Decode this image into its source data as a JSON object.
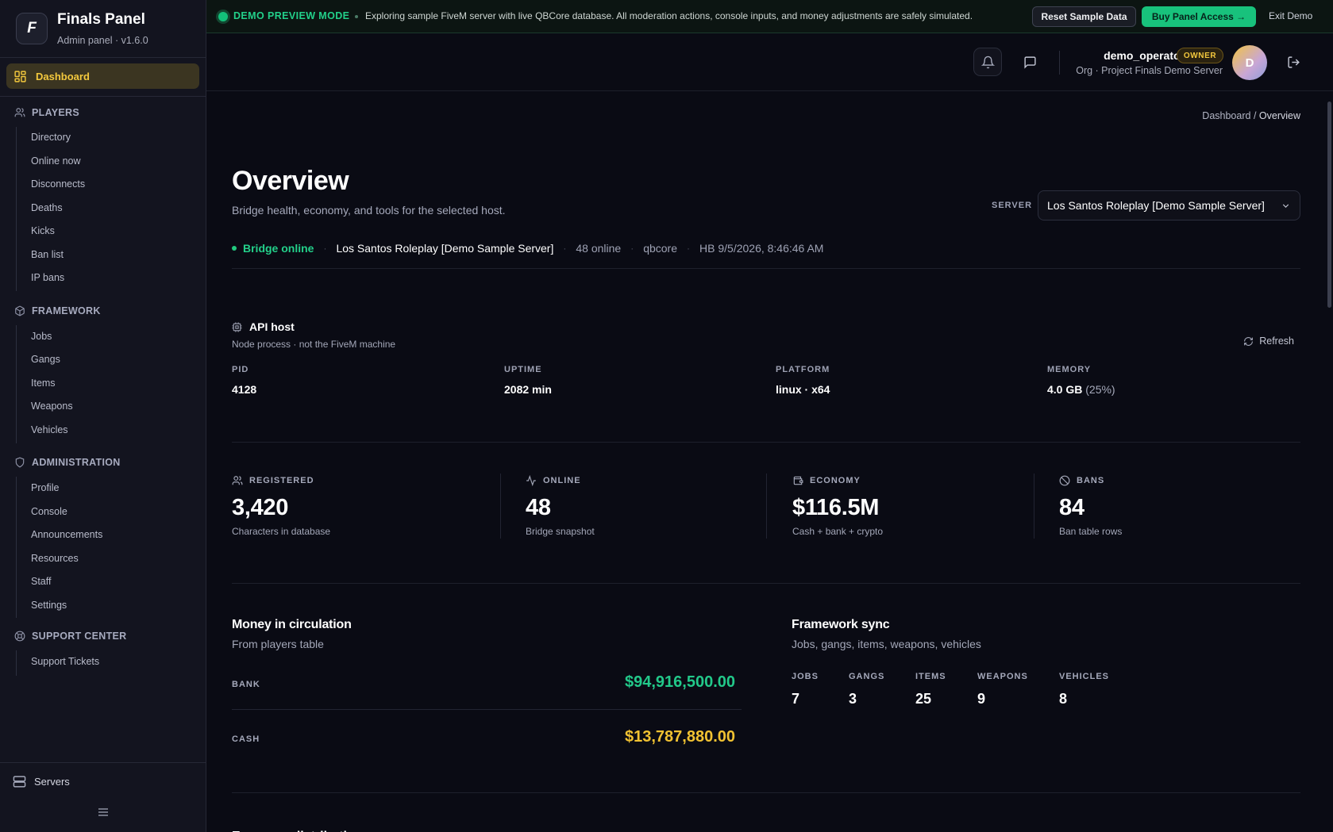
{
  "brand": {
    "logo_letter": "F",
    "title": "Finals Panel",
    "subtitle": "Admin panel · v1.6.0"
  },
  "sidebar": {
    "dashboard": "Dashboard",
    "sections": [
      {
        "title": "PLAYERS",
        "items": [
          "Directory",
          "Online now",
          "Disconnects",
          "Deaths",
          "Kicks",
          "Ban list",
          "IP bans"
        ]
      },
      {
        "title": "FRAMEWORK",
        "items": [
          "Jobs",
          "Gangs",
          "Items",
          "Weapons",
          "Vehicles"
        ]
      },
      {
        "title": "ADMINISTRATION",
        "items": [
          "Profile",
          "Console",
          "Announcements",
          "Resources",
          "Staff",
          "Settings"
        ]
      },
      {
        "title": "SUPPORT CENTER",
        "items": [
          "Support Tickets"
        ]
      }
    ],
    "servers": "Servers"
  },
  "banner": {
    "mode": "DEMO PREVIEW MODE",
    "text": "Exploring sample FiveM server with live QBCore database. All moderation actions, console inputs, and money adjustments are safely simulated.",
    "reset": "Reset Sample Data",
    "buy": "Buy Panel Access →",
    "exit": "Exit Demo"
  },
  "header": {
    "user": "demo_operator",
    "role": "OWNER",
    "org": "Org · Project Finals Demo Server",
    "avatar_letter": "D"
  },
  "breadcrumb": {
    "root": "Dashboard",
    "sep": "/",
    "current": "Overview"
  },
  "page": {
    "title": "Overview",
    "subtitle": "Bridge health, economy, and tools for the selected host.",
    "server_label": "SERVER",
    "server_selected": "Los Santos Roleplay [Demo Sample Server]"
  },
  "status": {
    "bridge": "Bridge online",
    "server": "Los Santos Roleplay [Demo Sample Server]",
    "online": "48 online",
    "framework": "qbcore",
    "heartbeat": "HB 9/5/2026, 8:46:46 AM",
    "sep": "·"
  },
  "api_host": {
    "title": "API host",
    "subtitle": "Node process · not the FiveM machine",
    "refresh": "Refresh",
    "fields": [
      {
        "label": "PID",
        "value": "4128",
        "extra": ""
      },
      {
        "label": "UPTIME",
        "value": "2082 min",
        "extra": ""
      },
      {
        "label": "PLATFORM",
        "value": "linux · x64",
        "extra": ""
      },
      {
        "label": "MEMORY",
        "value": "4.0 GB",
        "extra": "(25%)"
      }
    ]
  },
  "stats": [
    {
      "label": "REGISTERED",
      "value": "3,420",
      "sub": "Characters in database",
      "icon": "users-icon"
    },
    {
      "label": "ONLINE",
      "value": "48",
      "sub": "Bridge snapshot",
      "icon": "activity-icon"
    },
    {
      "label": "ECONOMY",
      "value": "$116.5M",
      "sub": "Cash + bank + crypto",
      "icon": "wallet-icon"
    },
    {
      "label": "BANS",
      "value": "84",
      "sub": "Ban table rows",
      "icon": "ban-icon"
    }
  ],
  "money": {
    "title": "Money in circulation",
    "subtitle": "From players table",
    "rows": [
      {
        "label": "BANK",
        "value": "$94,916,500.00",
        "color": "#22c98a"
      },
      {
        "label": "CASH",
        "value": "$13,787,880.00",
        "color": "#f1c232"
      }
    ]
  },
  "framework_sync": {
    "title": "Framework sync",
    "subtitle": "Jobs, gangs, items, weapons, vehicles",
    "items": [
      {
        "label": "JOBS",
        "value": "7"
      },
      {
        "label": "GANGS",
        "value": "3"
      },
      {
        "label": "ITEMS",
        "value": "25"
      },
      {
        "label": "WEAPONS",
        "value": "9"
      },
      {
        "label": "VEHICLES",
        "value": "8"
      }
    ]
  },
  "next_section_title": "Economy distribution",
  "colors": {
    "accent": "#f3c83d",
    "success": "#22d08a",
    "background": "#0a0b14",
    "sidebar": "#13141f"
  }
}
